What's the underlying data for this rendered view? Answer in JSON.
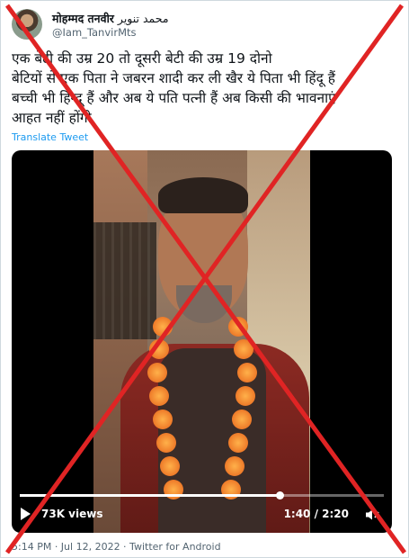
{
  "author": {
    "display_name": "मोहम्मद तनवीर",
    "display_name_urdu": "محمد تنویر",
    "handle": "@Iam_TanvirMts"
  },
  "tweet": {
    "text": "एक बेटी की उम्र 20 तो दूसरी बेटी की उम्र 19 दोनो\nबेटियों से एक पिता ने जबरन शादी कर ली खैर ये पिता भी हिंदू हैं\nबच्ची भी हिन्दू हैं और अब ये पति पत्नी हैं अब किसी की भावनाएं\nआहत नहीं होंगी",
    "translate_label": "Translate Tweet"
  },
  "video": {
    "views": "73K views",
    "time": "1:40 / 2:20",
    "progress": 0.714,
    "icons": [
      "play-icon",
      "volume-icon"
    ]
  },
  "meta": {
    "line": "5:14 PM · Jul 12, 2022 · Twitter for Android"
  },
  "overlay": {
    "cross_color": "#e02424"
  }
}
